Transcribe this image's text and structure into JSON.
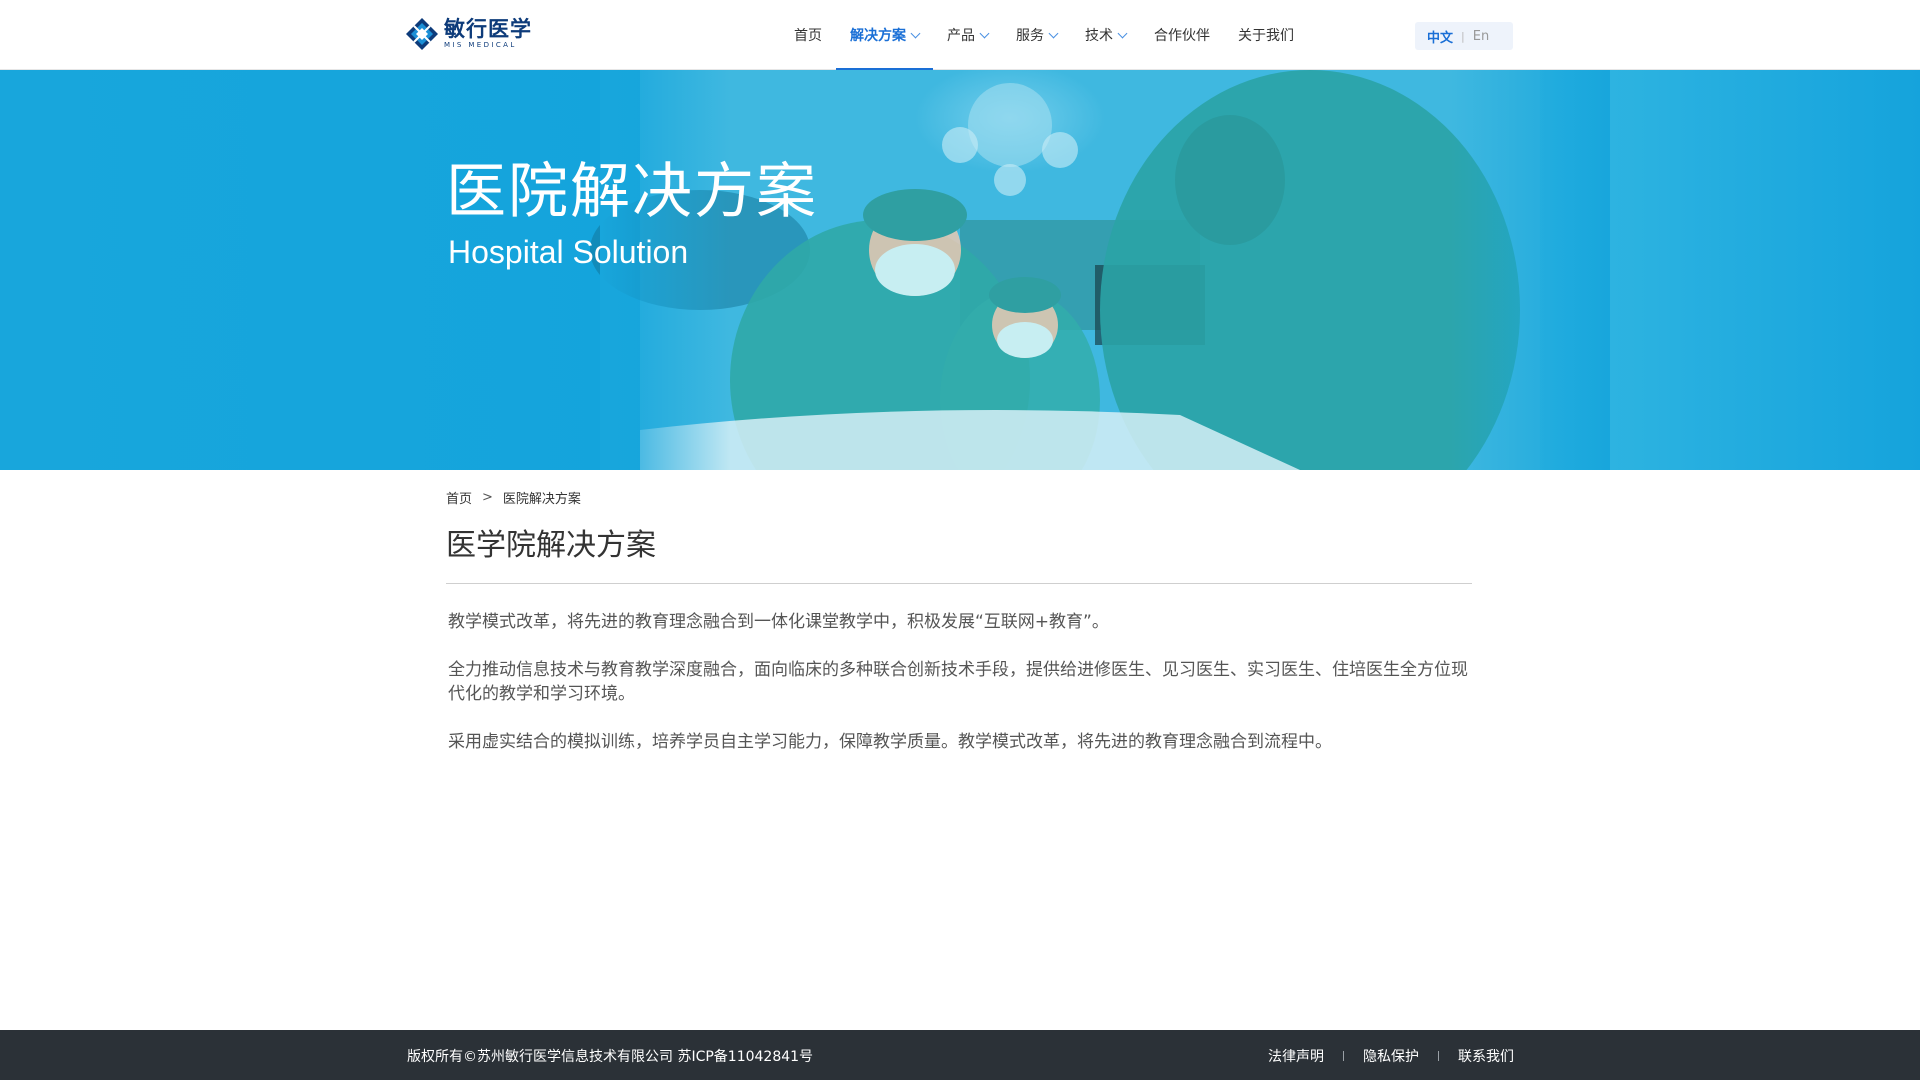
{
  "header": {
    "logo": {
      "cn": "敏行医学",
      "en": "MIS MEDICAL"
    },
    "nav": [
      {
        "label": "首页",
        "dropdown": false,
        "active": false
      },
      {
        "label": "解决方案",
        "dropdown": true,
        "active": true
      },
      {
        "label": "产品",
        "dropdown": true,
        "active": false
      },
      {
        "label": "服务",
        "dropdown": true,
        "active": false
      },
      {
        "label": "技术",
        "dropdown": true,
        "active": false
      },
      {
        "label": "合作伙伴",
        "dropdown": false,
        "active": false
      },
      {
        "label": "关于我们",
        "dropdown": false,
        "active": false
      }
    ],
    "lang": {
      "zh": "中文",
      "sep": "|",
      "en": "En",
      "selected": "中文"
    }
  },
  "banner": {
    "title": "医院解决方案",
    "subtitle": "Hospital Solution"
  },
  "breadcrumb": {
    "home": "首页",
    "sep": ">",
    "current": "医院解决方案"
  },
  "main": {
    "title": "医学院解决方案",
    "paragraphs": [
      "教学模式改革，将先进的教育理念融合到一体化课堂教学中，积极发展“互联网+教育”。",
      "全力推动信息技术与教育教学深度融合，面向临床的多种联合创新技术手段，提供给进修医生、见习医生、实习医生、住培医生全方位现代化的教学和学习环境。",
      "采用虚实结合的模拟训练，培养学员自主学习能力，保障教学质量。教学模式改革，将先进的教育理念融合到流程中。"
    ]
  },
  "footer": {
    "copyright": "版权所有©苏州敏行医学信息技术有限公司  苏ICP备11042841号",
    "links": [
      "法律声明",
      "隐私保护",
      "联系我们"
    ]
  },
  "colors": {
    "accent": "#1a6fd6",
    "banner": "#18a6dc",
    "footer": "#2b3137",
    "logo": "#0d3b7a"
  }
}
